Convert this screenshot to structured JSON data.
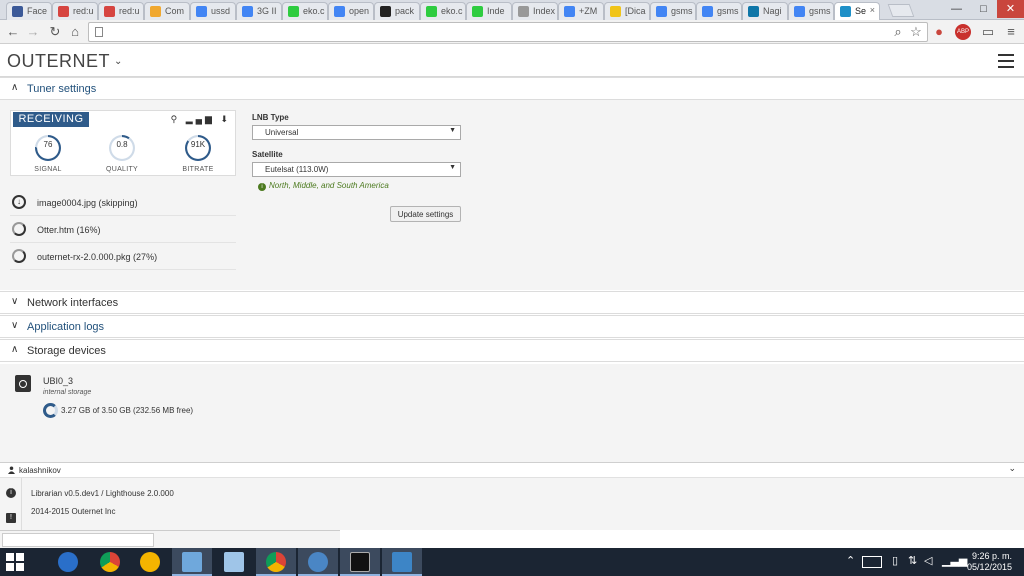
{
  "browser": {
    "tabs": [
      {
        "label": "Face",
        "color": "#3b5998"
      },
      {
        "label": "red:u",
        "color": "#d64541"
      },
      {
        "label": "red:u",
        "color": "#d64541"
      },
      {
        "label": "Com",
        "color": "#f0a830"
      },
      {
        "label": "ussd",
        "color": "#4285f4"
      },
      {
        "label": "3G II",
        "color": "#4285f4"
      },
      {
        "label": "eko.c",
        "color": "#2ecc40"
      },
      {
        "label": "open",
        "color": "#4285f4"
      },
      {
        "label": "pack",
        "color": "#222222"
      },
      {
        "label": "eko.c",
        "color": "#2ecc40"
      },
      {
        "label": "Inde",
        "color": "#2ecc40"
      },
      {
        "label": "Index",
        "color": "#999999"
      },
      {
        "label": "+ZM",
        "color": "#4285f4"
      },
      {
        "label": "[Dica",
        "color": "#f0c419"
      },
      {
        "label": "gsms",
        "color": "#4285f4"
      },
      {
        "label": "gsms",
        "color": "#4285f4"
      },
      {
        "label": "Nagi",
        "color": "#0e76a8"
      },
      {
        "label": "gsms",
        "color": "#4285f4"
      },
      {
        "label": "Se",
        "color": "#1e90c8"
      }
    ],
    "url": "",
    "window_buttons": {
      "minimize": "—",
      "maximize": "□",
      "close": "✕"
    }
  },
  "app": {
    "brand": "OUTERNET",
    "brand_chevron": "⌄"
  },
  "sections": {
    "tuner": {
      "label": "Tuner settings",
      "caret": "∧"
    },
    "network": {
      "label": "Network interfaces",
      "caret": "∨"
    },
    "logs": {
      "label": "Application logs",
      "caret": "∨"
    },
    "storage": {
      "label": "Storage devices",
      "caret": "∧"
    }
  },
  "tuner_status": {
    "state": "RECEIVING",
    "signal": {
      "value": "76",
      "label": "SIGNAL",
      "level": 0.76
    },
    "quality": {
      "value": "0.8",
      "label": "QUALITY",
      "level": 0.1
    },
    "bitrate": {
      "value": "91K",
      "label": "BITRATE",
      "level": 0.85
    },
    "icons": "🌡▂▄▆ ⬇"
  },
  "downloads": [
    {
      "name": "image0004.jpg (skipping)",
      "icon": "download-icon"
    },
    {
      "name": "Otter.htm (16%)",
      "icon": "progress-icon"
    },
    {
      "name": "outernet-rx-2.0.000.pkg (27%)",
      "icon": "progress-icon"
    }
  ],
  "lnb": {
    "label": "LNB Type",
    "value": "Universal"
  },
  "satellite": {
    "label": "Satellite",
    "value": "Eutelsat (113.0W)",
    "info": "North, Middle, and South America"
  },
  "update_button": "Update settings",
  "storage": {
    "device": "UBI0_3",
    "type": "internal storage",
    "usage": "3.27 GB of 3.50 GB (232.56 MB free)",
    "used_fraction": 0.93
  },
  "user": {
    "name": "kalashnikov"
  },
  "footer": {
    "version": "Librarian v0.5.dev1 / Lighthouse 2.0.000",
    "copyright": "2014-2015 Outernet Inc"
  },
  "taskbar": {
    "time": "9:26 p. m.",
    "date": "05/12/2015"
  }
}
